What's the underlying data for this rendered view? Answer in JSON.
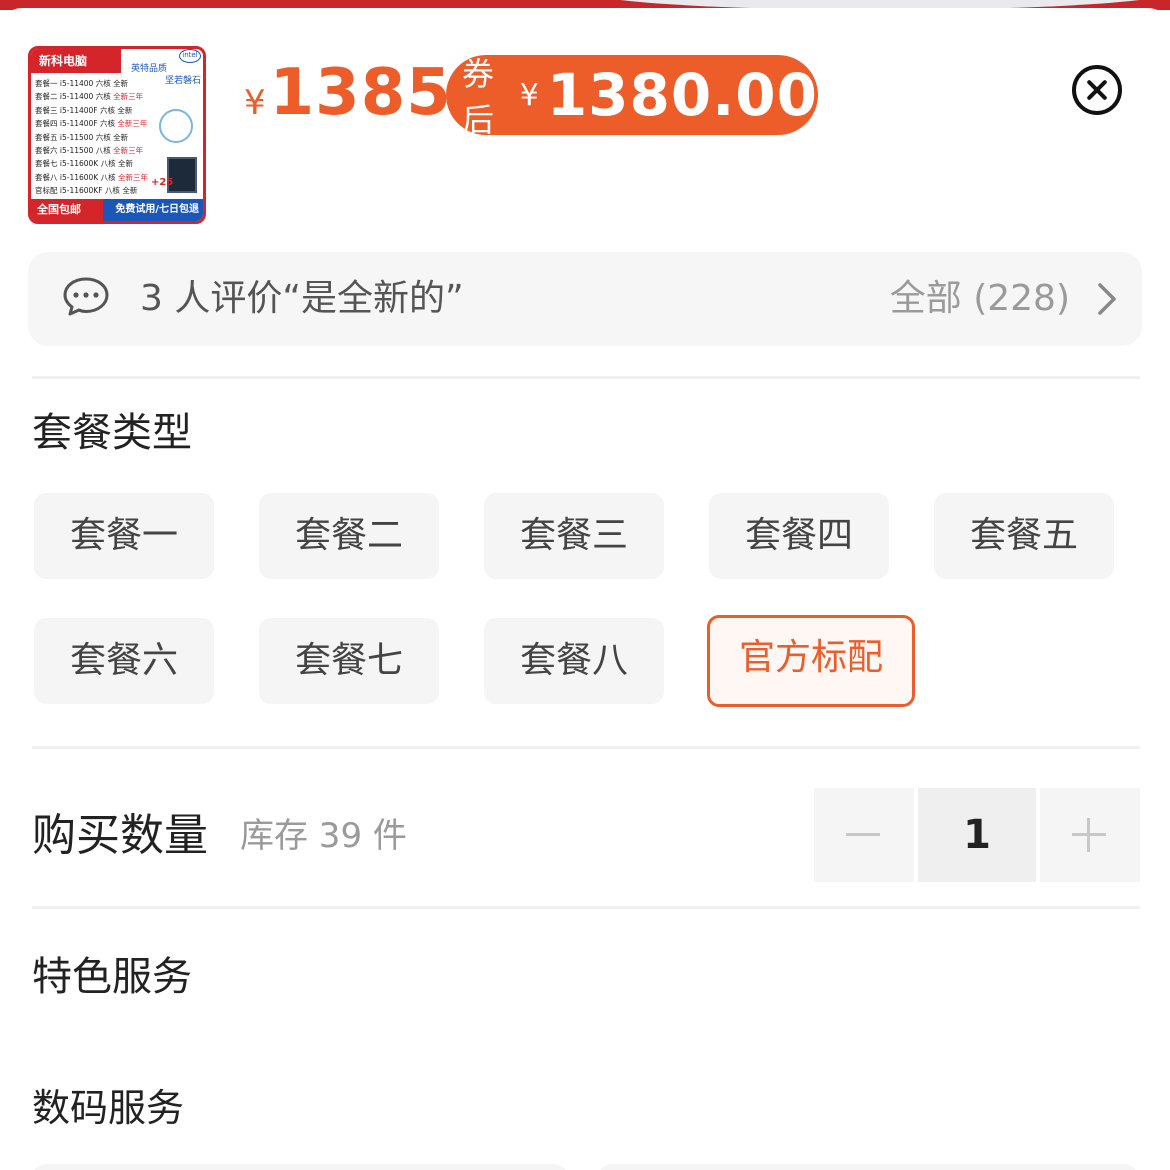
{
  "product": {
    "thumb": {
      "shop_name": "新科电脑",
      "slogan": "英特品质",
      "slogan2": "坚若磐石",
      "intel_logo": "intel",
      "lines": [
        {
          "pkg": "套餐一",
          "cpu": "i5-11400",
          "cores": "六核",
          "tag": "全新",
          "red": false
        },
        {
          "pkg": "套餐二",
          "cpu": "i5-11400",
          "cores": "六核",
          "tag": "全新三年",
          "red": true
        },
        {
          "pkg": "套餐三",
          "cpu": "i5-11400F",
          "cores": "六核",
          "tag": "全新",
          "red": false
        },
        {
          "pkg": "套餐四",
          "cpu": "i5-11400F",
          "cores": "六核",
          "tag": "全新三年",
          "red": true
        },
        {
          "pkg": "套餐五",
          "cpu": "i5-11500",
          "cores": "六核",
          "tag": "全新",
          "red": false
        },
        {
          "pkg": "套餐六",
          "cpu": "i5-11500",
          "cores": "八核",
          "tag": "全新三年",
          "red": true
        },
        {
          "pkg": "套餐七",
          "cpu": "i5-11600K",
          "cores": "八核",
          "tag": "全新",
          "red": false
        },
        {
          "pkg": "套餐八",
          "cpu": "i5-11600K",
          "cores": "八核",
          "tag": "全新三年",
          "red": true
        },
        {
          "pkg": "官标配",
          "cpu": "i5-11600KF",
          "cores": "八核",
          "tag": "全新",
          "red": false
        }
      ],
      "badge": "+25",
      "footer_left": "全国包邮",
      "footer_right": "免费试用/七日包退"
    },
    "price_symbol": "¥",
    "price": "1385",
    "coupon_label": "券后",
    "coupon_symbol": "¥",
    "coupon_price": "1380.00"
  },
  "review": {
    "text": "3 人评价“是全新的”",
    "all_label": "全部 (228)"
  },
  "package_section": {
    "title": "套餐类型",
    "options": [
      "套餐一",
      "套餐二",
      "套餐三",
      "套餐四",
      "套餐五",
      "套餐六",
      "套餐七",
      "套餐八",
      "官方标配"
    ],
    "selected": "官方标配"
  },
  "quantity": {
    "title": "购买数量",
    "stock": "库存 39 件",
    "value": "1"
  },
  "services": {
    "title": "特色服务",
    "subtitle": "数码服务"
  },
  "colors": {
    "accent": "#ec5d2a",
    "brand_red": "#d4252a"
  }
}
